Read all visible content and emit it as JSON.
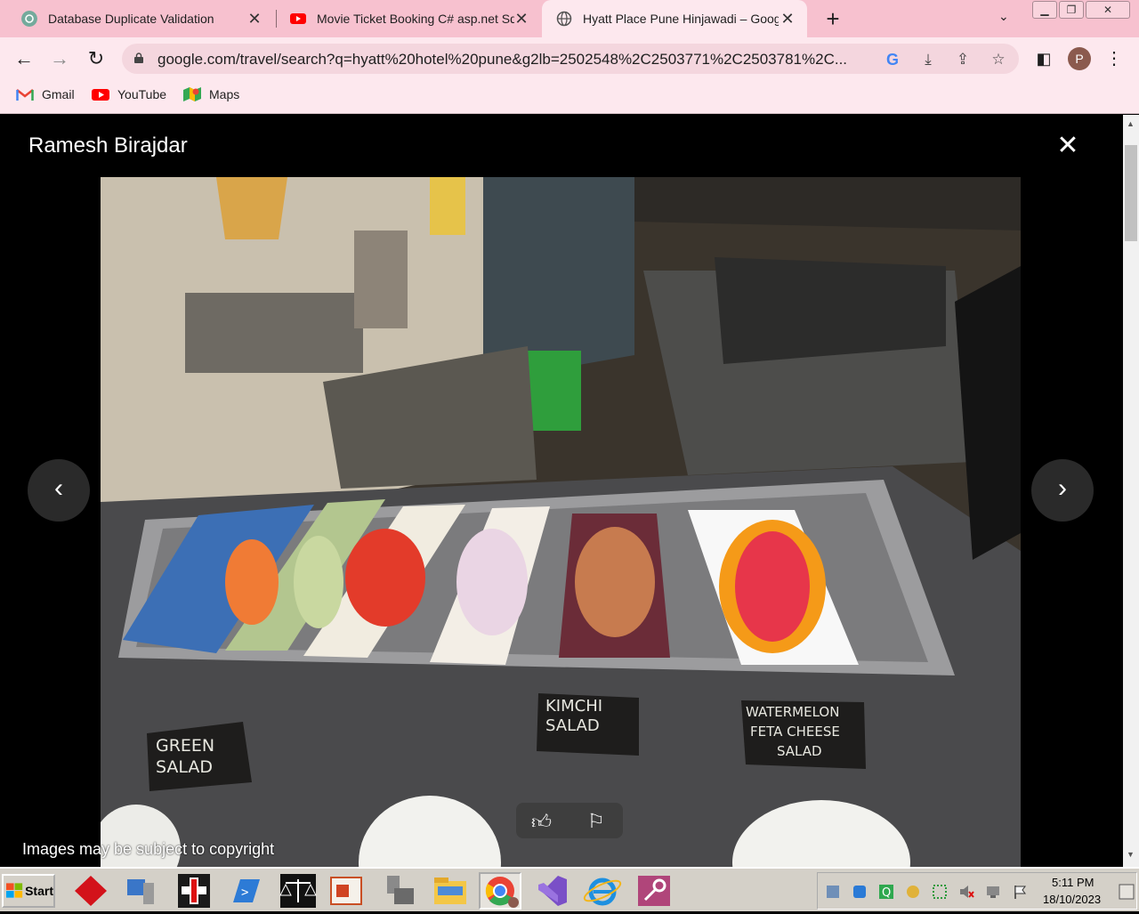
{
  "tabs": [
    {
      "title": "Database Duplicate Validation",
      "icon": "chatgpt-icon"
    },
    {
      "title": "Movie Ticket Booking C# asp.net Sq",
      "icon": "youtube-icon"
    },
    {
      "title": "Hyatt Place Pune Hinjawadi – Googl",
      "icon": "globe-icon",
      "active": true
    }
  ],
  "toolbar": {
    "url": "google.com/travel/search?q=hyatt%20hotel%20pune&g2lb=2502548%2C2503771%2C2503781%2C...",
    "profile_initial": "P"
  },
  "bookmarks": [
    {
      "label": "Gmail",
      "icon": "gmail-icon"
    },
    {
      "label": "YouTube",
      "icon": "youtube-icon"
    },
    {
      "label": "Maps",
      "icon": "maps-icon"
    }
  ],
  "lightbox": {
    "author": "Ramesh Birajdar",
    "copyright": "Images may be subject to copyright",
    "photo_labels": [
      "GREEN SALAD",
      "KIMCHI SALAD",
      "WATERMELON FETA CHEESE SALAD"
    ]
  },
  "taskbar": {
    "start_label": "Start",
    "time": "5:11 PM",
    "date": "18/10/2023"
  },
  "colors": {
    "tabstrip": "#f7c1cf",
    "toolbar": "#fde8ee",
    "lightbox_bg": "#000000"
  }
}
